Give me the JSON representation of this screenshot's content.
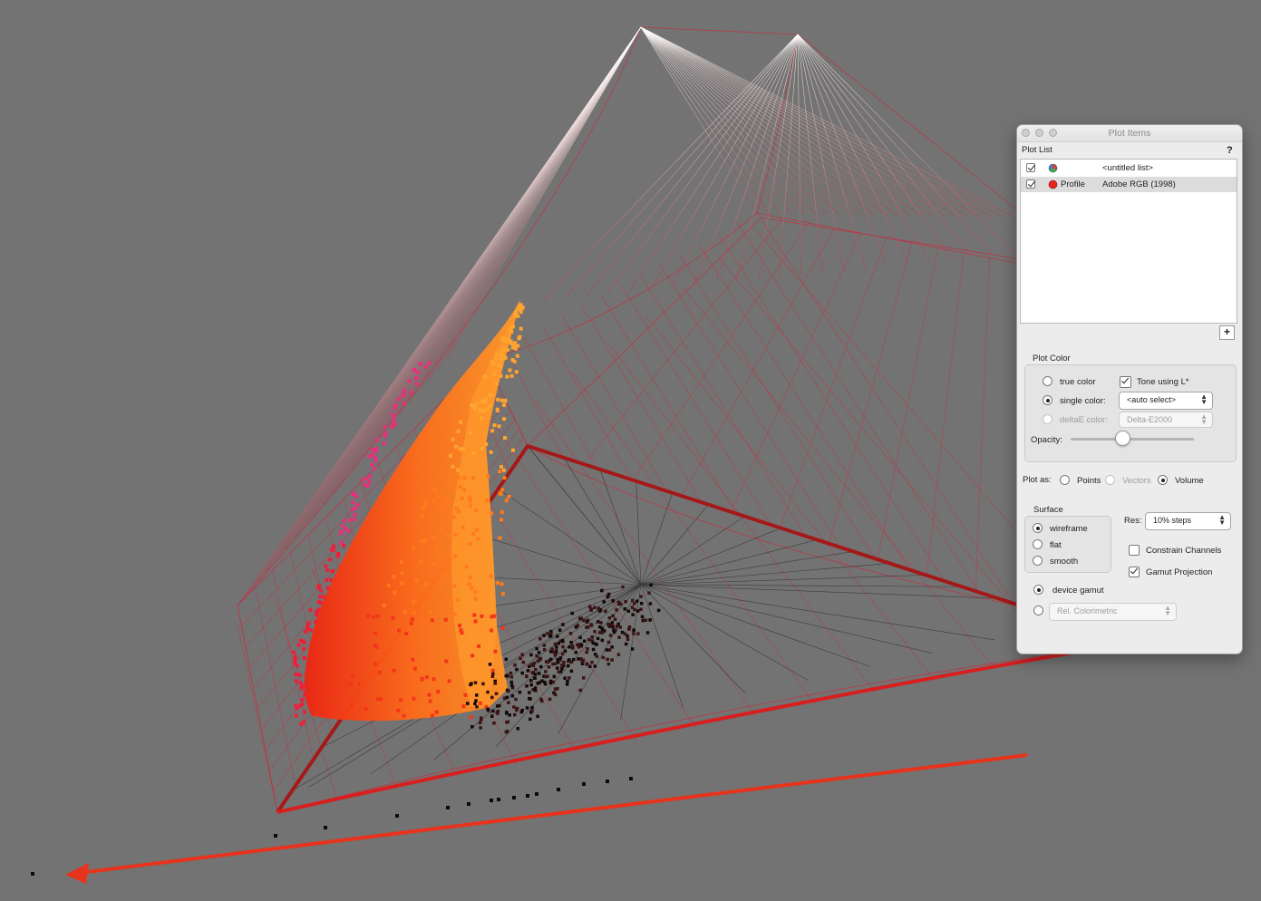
{
  "panel": {
    "title": "Plot Items",
    "help_glyph": "?",
    "plot_list": {
      "label": "Plot List",
      "rows": [
        {
          "checked": true,
          "icon": "color-wheel-icon",
          "type": "",
          "name": "<untitled list>",
          "selected": false
        },
        {
          "checked": true,
          "icon": "red-dot-icon",
          "type": "Profile",
          "name": "Adobe RGB (1998)",
          "selected": true
        }
      ],
      "add_button": "+"
    },
    "plot_color": {
      "label": "Plot Color",
      "true_color": "true color",
      "single_color": "single color:",
      "deltae_color": "deltaE color:",
      "selected_mode": "single color",
      "tone_using_l": "Tone using L*",
      "tone_checked": true,
      "single_color_value": "<auto select>",
      "deltae_value": "Delta-E2000",
      "opacity_label": "Opacity:",
      "opacity": 0.42
    },
    "plot_as": {
      "label": "Plot as:",
      "options": [
        "Points",
        "Vectors",
        "Volume"
      ],
      "selected": "Volume"
    },
    "surface": {
      "label": "Surface",
      "options": [
        "wireframe",
        "flat",
        "smooth"
      ],
      "selected": "wireframe",
      "res_label": "Res:",
      "res_value": "10% steps",
      "constrain_channels": "Constrain Channels",
      "constrain_checked": false,
      "gamut_projection": "Gamut Projection",
      "gamut_checked": true
    },
    "gamut": {
      "device_gamut": "device gamut",
      "device_selected": true,
      "intent_value": "Rel. Colorimetric"
    }
  },
  "colors": {
    "background": "#737373",
    "wireframe": "#c23040",
    "axis_arrow": "#e8331c",
    "volume_orange": "#ff8a1e",
    "volume_red": "#e81a10",
    "magenta_points": "#e8245a"
  }
}
